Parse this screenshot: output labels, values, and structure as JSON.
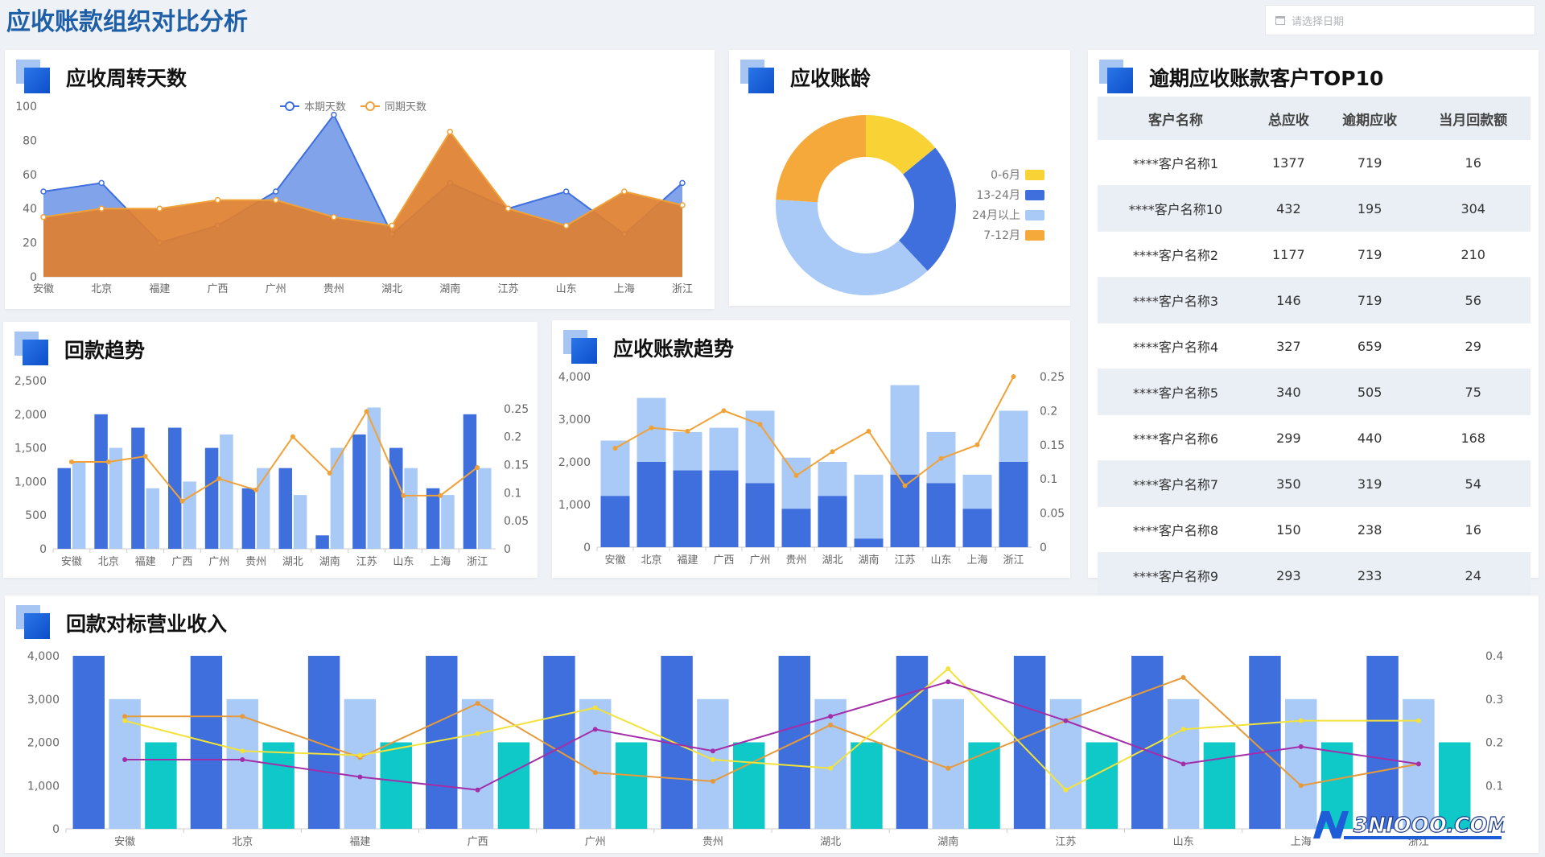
{
  "page": {
    "title": "应收账款组织对比分析",
    "date_placeholder": "请选择日期",
    "watermark": "3NIOOO.COM"
  },
  "panels": {
    "turnover": "应收周转天数",
    "aging": "应收账龄",
    "top10": "逾期应收账款客户TOP10",
    "collection": "回款趋势",
    "ar_trend": "应收账款趋势",
    "benchmark": "回款对标营业收入"
  },
  "colors": {
    "blue": "#3f6fdc",
    "light_blue": "#a9caf7",
    "orange": "#f0a238",
    "dark_orange": "#d9752a",
    "yellow": "#f9d336",
    "teal": "#0fc8c8",
    "purple": "#a32ea8",
    "gold": "#f2e23a"
  },
  "top10": {
    "headers": [
      "客户名称",
      "总应收",
      "逾期应收",
      "当月回款额"
    ],
    "rows": [
      [
        "****客户名称1",
        "1377",
        "719",
        "16"
      ],
      [
        "****客户名称10",
        "432",
        "195",
        "304"
      ],
      [
        "****客户名称2",
        "1177",
        "719",
        "210"
      ],
      [
        "****客户名称3",
        "146",
        "719",
        "56"
      ],
      [
        "****客户名称4",
        "327",
        "659",
        "29"
      ],
      [
        "****客户名称5",
        "340",
        "505",
        "75"
      ],
      [
        "****客户名称6",
        "299",
        "440",
        "168"
      ],
      [
        "****客户名称7",
        "350",
        "319",
        "54"
      ],
      [
        "****客户名称8",
        "150",
        "238",
        "16"
      ],
      [
        "****客户名称9",
        "293",
        "233",
        "24"
      ]
    ]
  },
  "chart_data": [
    {
      "id": "turnover",
      "type": "area",
      "categories": [
        "安徽",
        "北京",
        "福建",
        "广西",
        "广州",
        "贵州",
        "湖北",
        "湖南",
        "江苏",
        "山东",
        "上海",
        "浙江"
      ],
      "ylim": [
        0,
        100
      ],
      "yticks": [
        "0",
        "20",
        "40",
        "60",
        "80",
        "100"
      ],
      "legend_position": "top-center",
      "series": [
        {
          "name": "本期天数",
          "values": [
            50,
            55,
            20,
            30,
            50,
            95,
            25,
            55,
            40,
            50,
            25,
            55
          ],
          "color": "#3f6fdc",
          "fill": "#7a9ee8"
        },
        {
          "name": "同期天数",
          "values": [
            35,
            40,
            40,
            45,
            45,
            35,
            30,
            85,
            40,
            30,
            50,
            42
          ],
          "color": "#f0a238",
          "fill": "#e07f30"
        }
      ]
    },
    {
      "id": "aging",
      "type": "pie",
      "legend_position": "right",
      "labels": [
        "0-6月",
        "13-24月",
        "24月以上",
        "7-12月"
      ],
      "values": [
        14,
        24,
        38,
        24
      ],
      "colors": [
        "#f9d336",
        "#3f6fdc",
        "#a9caf7",
        "#f5a93a"
      ]
    },
    {
      "id": "collection",
      "type": "bar",
      "categories": [
        "安徽",
        "北京",
        "福建",
        "广西",
        "广州",
        "贵州",
        "湖北",
        "湖南",
        "江苏",
        "山东",
        "上海",
        "浙江"
      ],
      "ylim": [
        0,
        2500
      ],
      "yticks": [
        "0",
        "500",
        "1,000",
        "1,500",
        "2,000",
        "2,500"
      ],
      "y2lim": [
        0,
        0.3
      ],
      "y2ticks": [
        "0",
        "0.05",
        "0.1",
        "0.15",
        "0.2",
        "0.25"
      ],
      "series": [
        {
          "values": [
            1200,
            2000,
            1800,
            1800,
            1500,
            900,
            1200,
            200,
            1700,
            1500,
            900,
            2000
          ],
          "color": "#3f6fdc",
          "axis": "left",
          "kind": "bar"
        },
        {
          "values": [
            1300,
            1500,
            900,
            1000,
            1700,
            1200,
            800,
            1500,
            2100,
            1200,
            800,
            1200
          ],
          "color": "#a9caf7",
          "axis": "left",
          "kind": "bar"
        },
        {
          "values": [
            0.155,
            0.155,
            0.165,
            0.085,
            0.125,
            0.105,
            0.2,
            0.135,
            0.245,
            0.095,
            0.095,
            0.145
          ],
          "color": "#f0a238",
          "axis": "right",
          "kind": "line"
        }
      ]
    },
    {
      "id": "ar_trend",
      "type": "bar",
      "stacked": true,
      "categories": [
        "安徽",
        "北京",
        "福建",
        "广西",
        "广州",
        "贵州",
        "湖北",
        "湖南",
        "江苏",
        "山东",
        "上海",
        "浙江"
      ],
      "ylim": [
        0,
        4000
      ],
      "yticks": [
        "0",
        "1,000",
        "2,000",
        "3,000",
        "4,000"
      ],
      "y2lim": [
        0,
        0.25
      ],
      "y2ticks": [
        "0",
        "0.05",
        "0.1",
        "0.15",
        "0.2",
        "0.25"
      ],
      "series": [
        {
          "values": [
            1200,
            2000,
            1800,
            1800,
            1500,
            900,
            1200,
            200,
            1700,
            1500,
            900,
            2000
          ],
          "color": "#3f6fdc",
          "axis": "left",
          "kind": "bar"
        },
        {
          "values": [
            1300,
            1500,
            900,
            1000,
            1700,
            1200,
            800,
            1500,
            2100,
            1200,
            800,
            1200
          ],
          "color": "#a9caf7",
          "axis": "left",
          "kind": "bar"
        },
        {
          "values": [
            0.145,
            0.175,
            0.17,
            0.2,
            0.18,
            0.105,
            0.14,
            0.17,
            0.09,
            0.13,
            0.15,
            0.25
          ],
          "color": "#f0a238",
          "axis": "right",
          "kind": "line"
        }
      ]
    },
    {
      "id": "benchmark",
      "type": "bar",
      "categories": [
        "安徽",
        "北京",
        "福建",
        "广西",
        "广州",
        "贵州",
        "湖北",
        "湖南",
        "江苏",
        "山东",
        "上海",
        "浙江"
      ],
      "ylim": [
        0,
        4000
      ],
      "yticks": [
        "0",
        "1,000",
        "2,000",
        "3,000",
        "4,000"
      ],
      "y2lim": [
        0,
        0.4
      ],
      "y2ticks": [
        "0.1",
        "0.2",
        "0.3",
        "0.4"
      ],
      "series": [
        {
          "values": [
            4000,
            4000,
            4000,
            4000,
            4000,
            4000,
            4000,
            4000,
            4000,
            4000,
            4000,
            4000
          ],
          "color": "#3f6fdc",
          "axis": "left",
          "kind": "bar"
        },
        {
          "values": [
            3000,
            3000,
            3000,
            3000,
            3000,
            3000,
            3000,
            3000,
            3000,
            3000,
            3000,
            3000
          ],
          "color": "#a9caf7",
          "axis": "left",
          "kind": "bar"
        },
        {
          "values": [
            2000,
            2000,
            2000,
            2000,
            2000,
            2000,
            2000,
            2000,
            2000,
            2000,
            2000,
            2000
          ],
          "color": "#0fc8c8",
          "axis": "left",
          "kind": "bar"
        },
        {
          "values": [
            0.26,
            0.26,
            0.165,
            0.29,
            0.13,
            0.11,
            0.24,
            0.14,
            0.25,
            0.35,
            0.1,
            0.15
          ],
          "color": "#e79a3a",
          "axis": "right",
          "kind": "line"
        },
        {
          "values": [
            0.25,
            0.18,
            0.17,
            0.22,
            0.28,
            0.16,
            0.14,
            0.37,
            0.09,
            0.23,
            0.25,
            0.25
          ],
          "color": "#f2e23a",
          "axis": "right",
          "kind": "line"
        },
        {
          "values": [
            0.16,
            0.16,
            0.12,
            0.09,
            0.23,
            0.18,
            0.26,
            0.34,
            0.25,
            0.15,
            0.19,
            0.15
          ],
          "color": "#a32ea8",
          "axis": "right",
          "kind": "line"
        }
      ]
    }
  ]
}
